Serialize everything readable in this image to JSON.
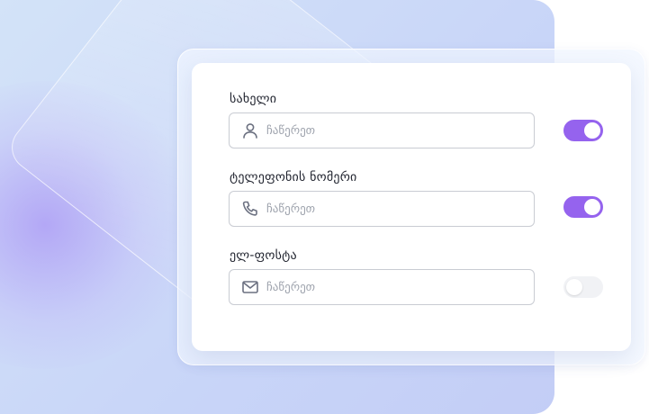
{
  "fields": [
    {
      "label": "სახელი",
      "placeholder": "ჩაწერეთ",
      "value": "",
      "icon": "user-icon",
      "enabled": true
    },
    {
      "label": "ტელეფონის ნომერი",
      "placeholder": "ჩაწერეთ",
      "value": "",
      "icon": "phone-icon",
      "enabled": true
    },
    {
      "label": "ელ-ფოსტა",
      "placeholder": "ჩაწერეთ",
      "value": "",
      "icon": "mail-icon",
      "enabled": false
    }
  ],
  "colors": {
    "toggle_on": "#9563ee",
    "toggle_off": "#f1f2f5",
    "icon": "#6b7080",
    "background": "#cfdcf8"
  }
}
